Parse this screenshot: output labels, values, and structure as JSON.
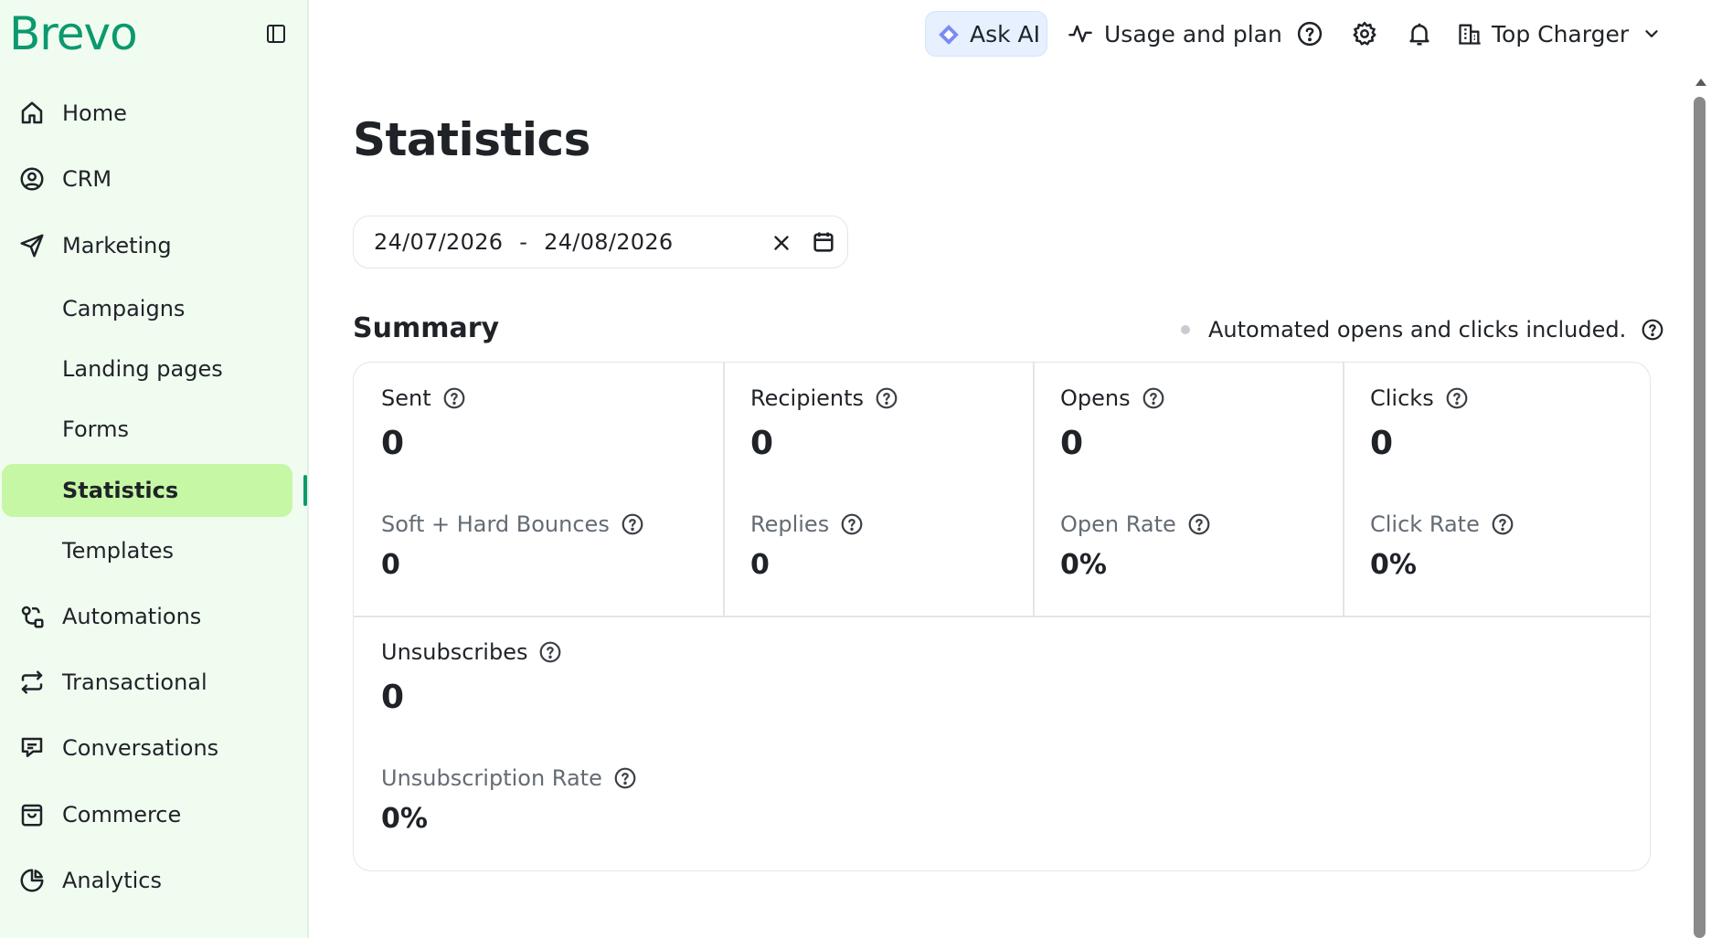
{
  "brand": {
    "logo_text": "Brevo",
    "accent": "#0b996e",
    "active_bg": "#c6f7a5",
    "sidebar_bg": "#f1fcf1"
  },
  "sidebar": {
    "items": [
      {
        "id": "home",
        "label": "Home",
        "icon": "home-icon"
      },
      {
        "id": "crm",
        "label": "CRM",
        "icon": "user-circle-icon"
      },
      {
        "id": "marketing",
        "label": "Marketing",
        "icon": "paper-plane-icon"
      },
      {
        "id": "automations",
        "label": "Automations",
        "icon": "automation-icon"
      },
      {
        "id": "transactional",
        "label": "Transactional",
        "icon": "arrows-exchange-icon"
      },
      {
        "id": "conversations",
        "label": "Conversations",
        "icon": "chat-bubbles-icon"
      },
      {
        "id": "commerce",
        "label": "Commerce",
        "icon": "shopping-bag-icon"
      },
      {
        "id": "analytics",
        "label": "Analytics",
        "icon": "pie-chart-icon"
      }
    ],
    "marketing_sub": [
      {
        "label": "Campaigns"
      },
      {
        "label": "Landing pages"
      },
      {
        "label": "Forms"
      },
      {
        "label": "Statistics",
        "active": true
      },
      {
        "label": "Templates"
      }
    ]
  },
  "topbar": {
    "ask_ai": "Ask AI",
    "usage": "Usage and plan",
    "org_name": "Top Charger"
  },
  "main": {
    "title": "Statistics",
    "date_range": {
      "start": "24/07/2026",
      "separator": "-",
      "end": "24/08/2026"
    },
    "summary_title": "Summary",
    "note": "Automated opens and clicks included.",
    "metrics": {
      "sent": {
        "label": "Sent",
        "value": "0"
      },
      "recipients": {
        "label": "Recipients",
        "value": "0"
      },
      "opens": {
        "label": "Opens",
        "value": "0"
      },
      "clicks": {
        "label": "Clicks",
        "value": "0"
      },
      "bounces": {
        "label": "Soft + Hard Bounces",
        "value": "0"
      },
      "replies": {
        "label": "Replies",
        "value": "0"
      },
      "open_rate": {
        "label": "Open Rate",
        "value": "0%"
      },
      "click_rate": {
        "label": "Click Rate",
        "value": "0%"
      },
      "unsubscribes": {
        "label": "Unsubscribes",
        "value": "0"
      },
      "unsub_rate": {
        "label": "Unsubscription Rate",
        "value": "0%"
      }
    }
  }
}
